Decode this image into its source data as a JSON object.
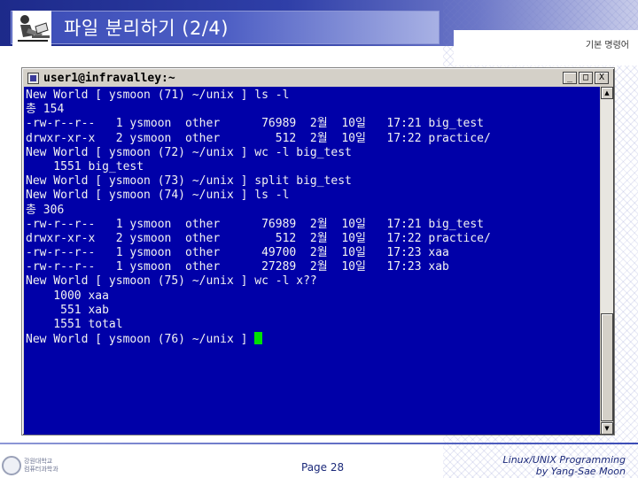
{
  "slide": {
    "title": "파일 분리하기 (2/4)",
    "section_label": "기본 명령어",
    "page_number": "Page 28",
    "credit_line1": "Linux/UNIX Programming",
    "credit_line2": "by Yang-Sae Moon",
    "footer_logo_text1": "강원대학교",
    "footer_logo_text2": "컴퓨터과학과"
  },
  "terminal": {
    "title": "user1@infravalley:~",
    "controls": {
      "minimize": "_",
      "maximize": "□",
      "close": "X"
    },
    "lines": [
      "New World [ ysmoon (71) ~/unix ] ls -l",
      "총 154",
      "-rw-r--r--   1 ysmoon  other      76989  2월  10일   17:21 big_test",
      "drwxr-xr-x   2 ysmoon  other        512  2월  10일   17:22 practice/",
      "New World [ ysmoon (72) ~/unix ] wc -l big_test",
      "    1551 big_test",
      "New World [ ysmoon (73) ~/unix ] split big_test",
      "New World [ ysmoon (74) ~/unix ] ls -l",
      "총 306",
      "-rw-r--r--   1 ysmoon  other      76989  2월  10일   17:21 big_test",
      "drwxr-xr-x   2 ysmoon  other        512  2월  10일   17:22 practice/",
      "-rw-r--r--   1 ysmoon  other      49700  2월  10일   17:23 xaa",
      "-rw-r--r--   1 ysmoon  other      27289  2월  10일   17:23 xab",
      "New World [ ysmoon (75) ~/unix ] wc -l x??",
      "    1000 xaa",
      "     551 xab",
      "    1551 total",
      "New World [ ysmoon (76) ~/unix ] "
    ]
  },
  "colors": {
    "terminal_bg": "#0000a8",
    "terminal_fg": "#f2f2f2",
    "cursor": "#00e000",
    "header_blue": "#2f3fa8"
  }
}
